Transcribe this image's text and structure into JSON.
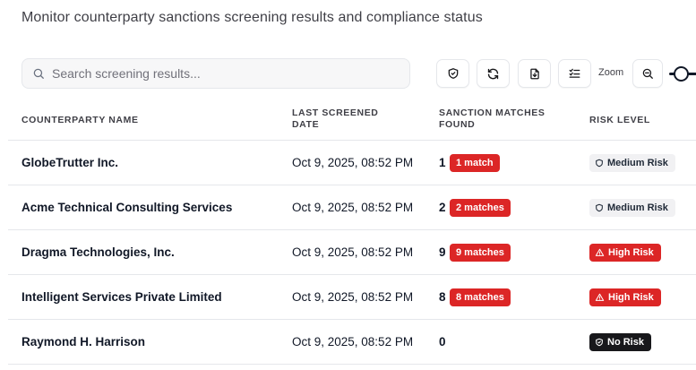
{
  "header": {
    "subtitle": "Monitor counterparty sanctions screening results and compliance status"
  },
  "toolbar": {
    "search_placeholder": "Search screening results...",
    "zoom_label": "Zoom",
    "icons": [
      "shield-icon",
      "refresh-icon",
      "export-file-icon",
      "checklist-icon",
      "zoom-out-icon"
    ]
  },
  "table": {
    "columns": {
      "name": "COUNTERPARTY NAME",
      "date": "LAST SCREENED DATE",
      "matches": "SANCTION MATCHES FOUND",
      "risk": "RISK LEVEL"
    },
    "rows": [
      {
        "name": "GlobeTrutter Inc.",
        "date": "Oct 9, 2025, 08:52 PM",
        "count": "1",
        "badge": "1 match",
        "risk": "Medium Risk",
        "risk_level": "medium"
      },
      {
        "name": "Acme Technical Consulting Services",
        "date": "Oct 9, 2025, 08:52 PM",
        "count": "2",
        "badge": "2 matches",
        "risk": "Medium Risk",
        "risk_level": "medium"
      },
      {
        "name": "Dragma Technologies, Inc.",
        "date": "Oct 9, 2025, 08:52 PM",
        "count": "9",
        "badge": "9 matches",
        "risk": "High Risk",
        "risk_level": "high"
      },
      {
        "name": "Intelligent Services Private Limited",
        "date": "Oct 9, 2025, 08:52 PM",
        "count": "8",
        "badge": "8 matches",
        "risk": "High Risk",
        "risk_level": "high"
      },
      {
        "name": "Raymond H. Harrison",
        "date": "Oct 9, 2025, 08:52 PM",
        "count": "0",
        "badge": "",
        "risk": "No Risk",
        "risk_level": "none"
      }
    ]
  },
  "colors": {
    "danger": "#dc2626",
    "neutral_badge": "#f1f1f3",
    "dark_badge": "#18181b",
    "border": "#e5e7eb"
  }
}
